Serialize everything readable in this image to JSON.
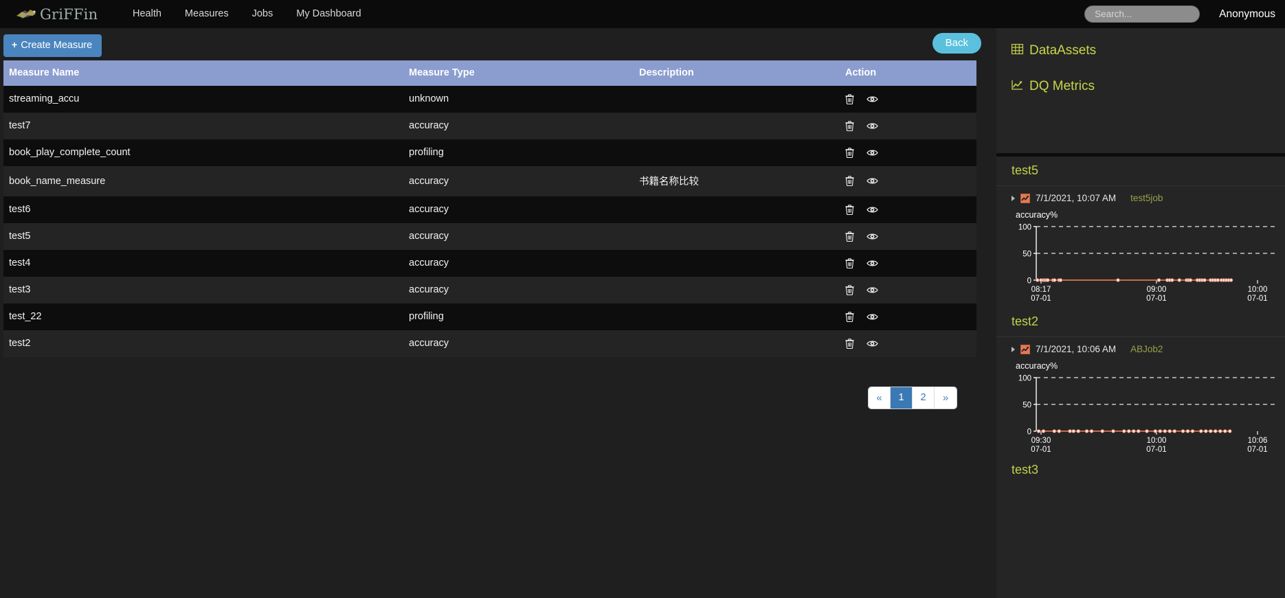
{
  "navbar": {
    "brand": "GriFFin",
    "brand_icon": "griffin-logo-icon",
    "links": [
      {
        "label": "Health",
        "name": "nav-health"
      },
      {
        "label": "Measures",
        "name": "nav-measures"
      },
      {
        "label": "Jobs",
        "name": "nav-jobs"
      },
      {
        "label": "My Dashboard",
        "name": "nav-my-dashboard"
      }
    ],
    "search_placeholder": "Search...",
    "search_value": "",
    "user": "Anonymous"
  },
  "toolbar": {
    "create_label": "Create Measure",
    "create_icon": "plus-icon",
    "back_label": "Back"
  },
  "table": {
    "columns": [
      "Measure Name",
      "Measure Type",
      "Description",
      "Action"
    ],
    "rows": [
      {
        "name": "streaming_accu",
        "type": "unknown",
        "desc": ""
      },
      {
        "name": "test7",
        "type": "accuracy",
        "desc": ""
      },
      {
        "name": "book_play_complete_count",
        "type": "profiling",
        "desc": ""
      },
      {
        "name": "book_name_measure",
        "type": "accuracy",
        "desc": "书籍名称比较"
      },
      {
        "name": "test6",
        "type": "accuracy",
        "desc": ""
      },
      {
        "name": "test5",
        "type": "accuracy",
        "desc": ""
      },
      {
        "name": "test4",
        "type": "accuracy",
        "desc": ""
      },
      {
        "name": "test3",
        "type": "accuracy",
        "desc": ""
      },
      {
        "name": "test_22",
        "type": "profiling",
        "desc": ""
      },
      {
        "name": "test2",
        "type": "accuracy",
        "desc": ""
      }
    ],
    "action_icons": [
      "trash-icon",
      "eye-icon"
    ]
  },
  "pagination": {
    "first_label": "«",
    "last_label": "»",
    "pages": [
      "1",
      "2"
    ],
    "active": "1"
  },
  "sidebar": {
    "links": [
      {
        "label": "DataAssets",
        "icon": "table-grid-icon",
        "name": "sidebar-item-dataassets"
      },
      {
        "label": "DQ Metrics",
        "icon": "line-chart-icon",
        "name": "sidebar-item-dq-metrics"
      }
    ],
    "metrics": [
      {
        "title": "test5",
        "timestamp": "7/1/2021, 10:07 AM",
        "job": "test5job",
        "icon": "chart-thumb-icon"
      },
      {
        "title": "test2",
        "timestamp": "7/1/2021, 10:06 AM",
        "job": "ABJob2",
        "icon": "chart-thumb-icon"
      }
    ],
    "next_title": "test3"
  },
  "chart_data": [
    {
      "type": "line",
      "title": "test5",
      "ylabel": "accuracy%",
      "xlabel": "",
      "ylim": [
        0,
        100
      ],
      "yticks": [
        0,
        50,
        100
      ],
      "ytick_labels": [
        "0",
        "50",
        "100"
      ],
      "xtick_labels": [
        "08:17\n07-01",
        "09:00\n07-01",
        "10:00\n07-01"
      ],
      "xticks_top": [
        "08:17",
        "09:00",
        "10:00"
      ],
      "xticks_bottom": [
        "07-01",
        "07-01",
        "07-01"
      ],
      "grid": true,
      "legend": "none",
      "series": [
        {
          "name": "accuracy%",
          "color": "#c96a4d",
          "x": [
            0.5,
            2.0,
            3.0,
            3.6,
            4.2,
            4.8,
            7.0,
            7.6,
            9.5,
            10.1,
            34.0,
            51.0,
            54.5,
            55.5,
            56.5,
            59.5,
            62.5,
            63.3,
            64.1,
            67.0,
            68.0,
            69.0,
            70.0,
            72.5,
            73.5,
            74.5,
            75.5,
            77.0,
            78.0,
            79.0,
            80.0,
            81.0
          ],
          "values": [
            0,
            0,
            0,
            0,
            0,
            0,
            0,
            0,
            0,
            0,
            0,
            0,
            0,
            0,
            0,
            0,
            0,
            0,
            0,
            0,
            0,
            0,
            0,
            0,
            0,
            0,
            0,
            0,
            0,
            0,
            0,
            0
          ]
        }
      ]
    },
    {
      "type": "line",
      "title": "test2",
      "ylabel": "accuracy%",
      "xlabel": "",
      "ylim": [
        0,
        100
      ],
      "yticks": [
        0,
        50,
        100
      ],
      "ytick_labels": [
        "0",
        "50",
        "100"
      ],
      "xtick_labels": [
        "09:30\n07-01",
        "10:00\n07-01",
        "10:06\n07-01"
      ],
      "xticks_top": [
        "09:30",
        "10:00",
        "10:06"
      ],
      "xticks_bottom": [
        "07-01",
        "07-01",
        "07-01"
      ],
      "grid": true,
      "legend": "none",
      "series": [
        {
          "name": "accuracy%",
          "color": "#c96a4d",
          "x": [
            1.0,
            3.0,
            7.5,
            9.5,
            14.0,
            15.5,
            17.5,
            21.0,
            23.0,
            27.5,
            32.0,
            36.5,
            38.5,
            40.5,
            42.5,
            46.0,
            49.5,
            51.5,
            53.5,
            55.5,
            57.5,
            61.0,
            63.0,
            65.0,
            68.5,
            70.5,
            72.5,
            74.5,
            76.5,
            78.5,
            80.5
          ],
          "values": [
            0,
            0,
            0,
            0,
            0,
            0,
            0,
            0,
            0,
            0,
            0,
            0,
            0,
            0,
            0,
            0,
            0,
            0,
            0,
            0,
            0,
            0,
            0,
            0,
            0,
            0,
            0,
            0,
            0,
            0,
            0
          ]
        }
      ]
    }
  ],
  "colors": {
    "accent_blue": "#4a85bf",
    "back_blue": "#5bc0de",
    "table_header": "#8b9dcf",
    "sidebar_link": "#c8d64a",
    "series_orange": "#c96a4d",
    "page_bg": "#1f1f1f"
  }
}
